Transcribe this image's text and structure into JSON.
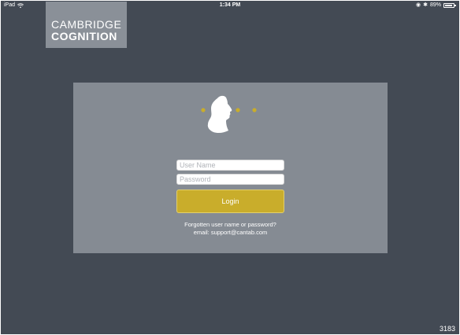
{
  "status_bar": {
    "device": "iPad",
    "time": "1:34 PM",
    "battery": "89%",
    "battery_level": 0.89
  },
  "logo": {
    "line1": "CAMBRIDGE",
    "line2": "COGNITION"
  },
  "login": {
    "username_placeholder": "User Name",
    "password_placeholder": "Password",
    "button_label": "Login",
    "forgot_text": "Forgotten user name or password?",
    "support_text": "email: support@cantab.com"
  },
  "footer": {
    "code": "3183"
  },
  "colors": {
    "background": "#434a54",
    "panel": "#858b93",
    "logo_box": "#8a9098",
    "accent": "#c9ad2b"
  },
  "icons": {
    "brand_mark": "head-profile-with-dots-icon"
  }
}
